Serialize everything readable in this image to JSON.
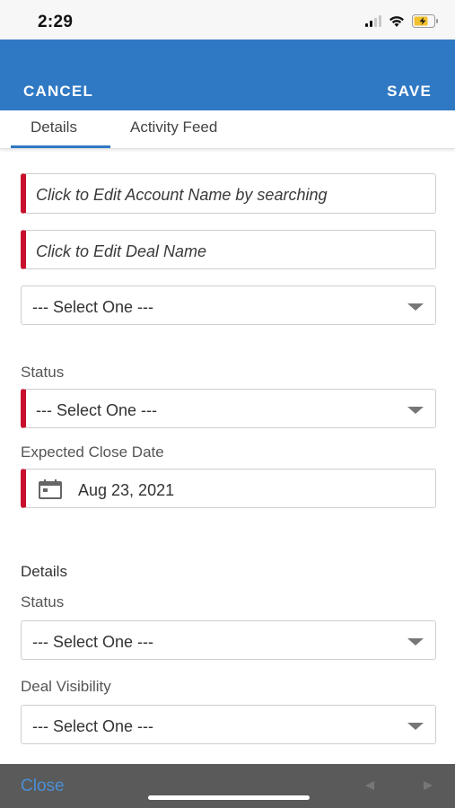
{
  "status_bar": {
    "time": "2:29"
  },
  "appbar": {
    "cancel_label": "CANCEL",
    "save_label": "SAVE"
  },
  "tabs": [
    {
      "label": "Details",
      "active": true
    },
    {
      "label": "Activity Feed",
      "active": false
    }
  ],
  "form": {
    "account_name_placeholder": "Click to Edit Account Name by searching",
    "deal_name_placeholder": "Click to Edit Deal Name",
    "first_select": "--- Select One ---",
    "status_label": "Status",
    "status_value": "--- Select One ---",
    "close_date_label": "Expected Close Date",
    "close_date_value": "Aug 23, 2021",
    "details_section_title": "Details",
    "details_status_label": "Status",
    "details_status_value": "--- Select One ---",
    "deal_visibility_label": "Deal Visibility",
    "deal_visibility_value": "--- Select One ---"
  },
  "bottom_bar": {
    "close_label": "Close"
  },
  "colors": {
    "brand": "#2f79c4",
    "required": "#c8102e",
    "bottom_bar": "#5a5a5a"
  },
  "icons": [
    "signal-icon",
    "wifi-icon",
    "battery-icon",
    "calendar-icon",
    "dropdown-caret-icon"
  ]
}
